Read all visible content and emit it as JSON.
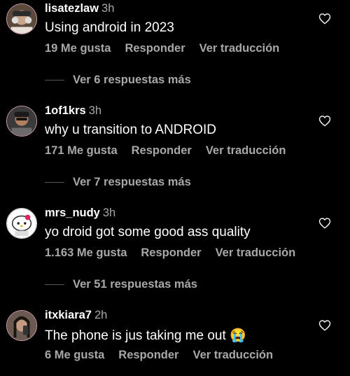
{
  "comments": [
    {
      "user": "lisatezlaw",
      "time": "3h",
      "text": "Using android in 2023",
      "likes": "19 Me gusta",
      "reply": "Responder",
      "translate": "Ver traducción",
      "more": "Ver 6 respuestas más"
    },
    {
      "user": "1of1krs",
      "time": "3h",
      "text": "why u transition to ANDROID",
      "likes": "171 Me gusta",
      "reply": "Responder",
      "translate": "Ver traducción",
      "more": "Ver 7 respuestas más"
    },
    {
      "user": "mrs_nudy",
      "time": "3h",
      "text": "yo droid got some good ass quality",
      "likes": "1.163 Me gusta",
      "reply": "Responder",
      "translate": "Ver traducción",
      "more": "Ver 51 respuestas más"
    },
    {
      "user": "itxkiara7",
      "time": "2h",
      "text": "The phone is jus taking me out 😭",
      "likes": "6 Me gusta",
      "reply": "Responder",
      "translate": "Ver traducción"
    }
  ]
}
